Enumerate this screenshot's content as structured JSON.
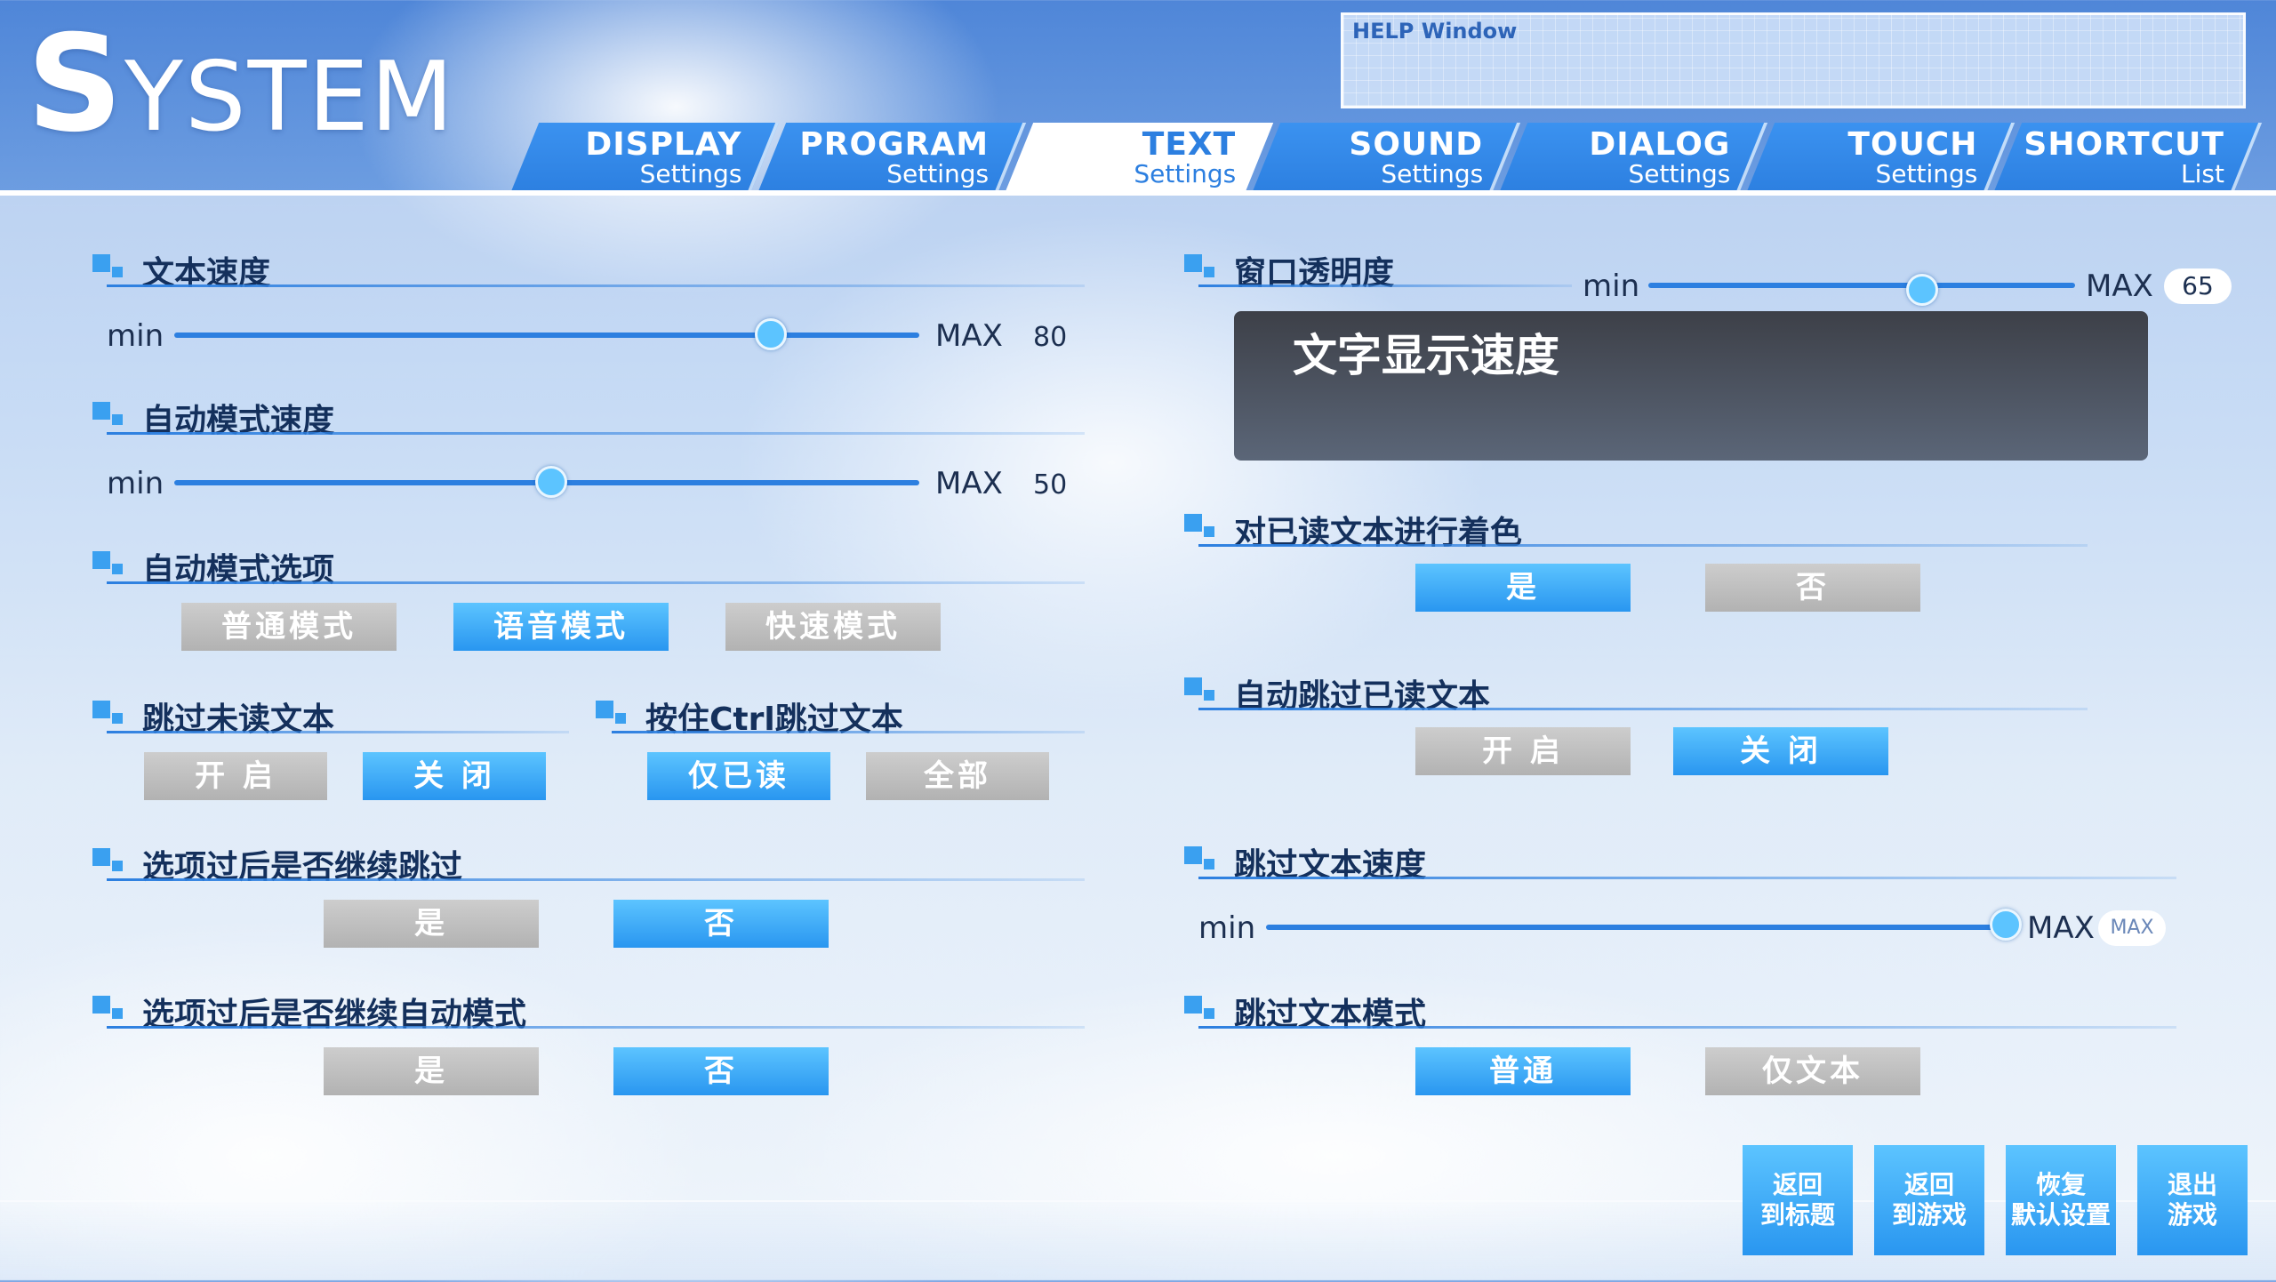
{
  "header": {
    "title_first": "S",
    "title_rest": "YSTEM",
    "help_label": "HELP Window",
    "tabs": [
      {
        "t1": "DISPLAY",
        "t2": "Settings"
      },
      {
        "t1": "PROGRAM",
        "t2": "Settings"
      },
      {
        "t1": "TEXT",
        "t2": "Settings"
      },
      {
        "t1": "SOUND",
        "t2": "Settings"
      },
      {
        "t1": "DIALOG",
        "t2": "Settings"
      },
      {
        "t1": "TOUCH",
        "t2": "Settings"
      },
      {
        "t1": "SHORTCUT",
        "t2": "List"
      }
    ],
    "active_tab": "TEXT"
  },
  "sliders_common": {
    "min": "min",
    "max": "MAX"
  },
  "left": {
    "text_speed": {
      "title": "文本速度",
      "value": "80",
      "level": 0.8
    },
    "auto_speed": {
      "title": "自动模式速度",
      "value": "50",
      "level": 0.5
    },
    "auto_option": {
      "title": "自动模式选项",
      "buttons": [
        "普通模式",
        "语音模式",
        "快速模式"
      ],
      "selected": "语音模式"
    },
    "skip_unread": {
      "title": "跳过未读文本",
      "buttons": [
        "开 启",
        "关 闭"
      ],
      "selected": "关 闭"
    },
    "ctrl_skip": {
      "title": "按住Ctrl跳过文本",
      "buttons": [
        "仅已读",
        "全部"
      ],
      "selected": "仅已读"
    },
    "continue_skip": {
      "title": "选项过后是否继续跳过",
      "buttons": [
        "是",
        "否"
      ],
      "selected": "否"
    },
    "continue_auto": {
      "title": "选项过后是否继续自动模式",
      "buttons": [
        "是",
        "否"
      ],
      "selected": "否"
    }
  },
  "right": {
    "window_opacity": {
      "title": "窗口透明度",
      "value": "65",
      "level": 0.65
    },
    "preview_text": "文字显示速度",
    "color_read": {
      "title": "对已读文本进行着色",
      "buttons": [
        "是",
        "否"
      ],
      "selected": "是"
    },
    "auto_skip_read": {
      "title": "自动跳过已读文本",
      "buttons": [
        "开 启",
        "关 闭"
      ],
      "selected": "关 闭"
    },
    "skip_speed": {
      "title": "跳过文本速度",
      "value": "MAX",
      "level": 1.0
    },
    "skip_mode": {
      "title": "跳过文本模式",
      "buttons": [
        "普通",
        "仅文本"
      ],
      "selected": "普通"
    }
  },
  "footer": {
    "buttons": [
      {
        "l1": "返回",
        "l2": "到标题"
      },
      {
        "l1": "返回",
        "l2": "到游戏"
      },
      {
        "l1": "恢复",
        "l2": "默认设置"
      },
      {
        "l1": "退出",
        "l2": "游戏"
      }
    ]
  },
  "colors": {
    "accent": "#2c7fe0",
    "button_on": "#3aa8f5",
    "button_off": "#bdbdbd",
    "title_text": "#14305c"
  }
}
